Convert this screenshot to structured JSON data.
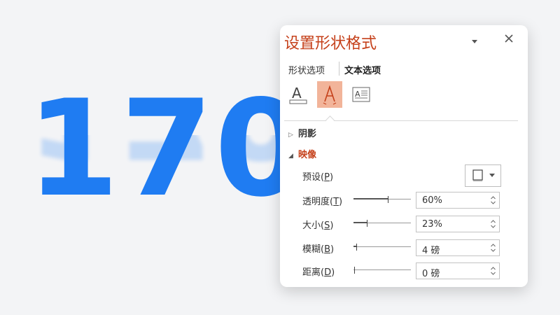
{
  "canvas": {
    "big_number": "170",
    "number_color": "#1f7cf2"
  },
  "panel": {
    "title": "设置形状格式",
    "title_color": "#c5401a",
    "dropdown_icon": "chevron-down-icon",
    "close_icon": "close-icon",
    "tabs": [
      {
        "label": "形状选项",
        "active": false
      },
      {
        "label": "文本选项",
        "active": true
      }
    ],
    "icon_tabs": [
      {
        "name": "text-fill-outline-icon",
        "selected": false
      },
      {
        "name": "text-effects-icon",
        "selected": true
      },
      {
        "name": "textbox-icon",
        "selected": false
      }
    ],
    "sections": [
      {
        "label": "阴影",
        "expanded": false
      },
      {
        "label": "映像",
        "expanded": true
      }
    ],
    "preset": {
      "label": "预设",
      "accel": "P"
    },
    "rows": [
      {
        "label": "透明度",
        "accel": "T",
        "value": "60%",
        "slider_fraction": 0.6
      },
      {
        "label": "大小",
        "accel": "S",
        "value": "23%",
        "slider_fraction": 0.23
      },
      {
        "label": "模糊",
        "accel": "B",
        "value": "4 磅",
        "slider_fraction": 0.04
      },
      {
        "label": "距离",
        "accel": "D",
        "value": "0 磅",
        "slider_fraction": 0.0
      }
    ],
    "accent_selected_bg": "#f2b49a"
  }
}
